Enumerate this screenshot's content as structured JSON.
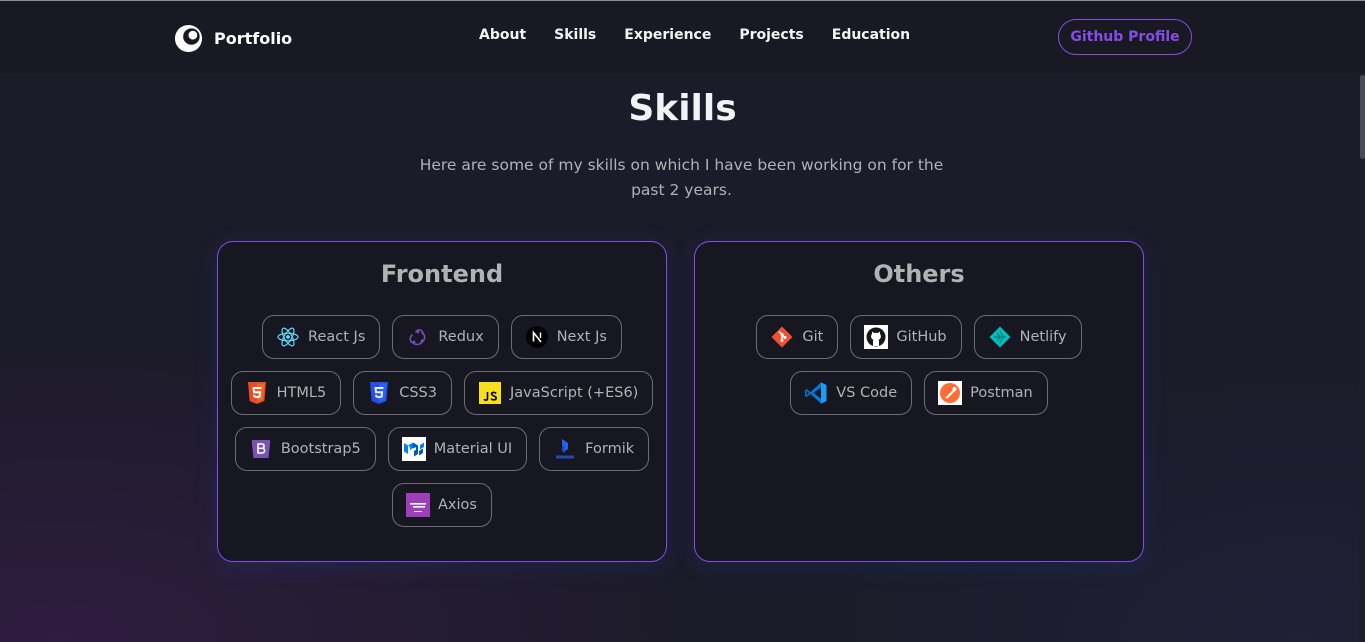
{
  "navbar": {
    "brand": "Portfolio",
    "links": [
      "About",
      "Skills",
      "Experience",
      "Projects",
      "Education"
    ],
    "github_button": "Github Profile"
  },
  "skills_section": {
    "title": "Skills",
    "description": "Here are some of my skills on which I have been working on for the past 2 years."
  },
  "categories": [
    {
      "title": "Frontend",
      "skills": [
        {
          "name": "React Js",
          "icon": "react-icon"
        },
        {
          "name": "Redux",
          "icon": "redux-icon"
        },
        {
          "name": "Next Js",
          "icon": "nextjs-icon"
        },
        {
          "name": "HTML5",
          "icon": "html5-icon"
        },
        {
          "name": "CSS3",
          "icon": "css3-icon"
        },
        {
          "name": "JavaScript (+ES6)",
          "icon": "javascript-icon"
        },
        {
          "name": "Bootstrap5",
          "icon": "bootstrap-icon"
        },
        {
          "name": "Material UI",
          "icon": "material-ui-icon"
        },
        {
          "name": "Formik",
          "icon": "formik-icon"
        },
        {
          "name": "Axios",
          "icon": "axios-icon"
        }
      ]
    },
    {
      "title": "Others",
      "skills": [
        {
          "name": "Git",
          "icon": "git-icon"
        },
        {
          "name": "GitHub",
          "icon": "github-icon"
        },
        {
          "name": "Netlify",
          "icon": "netlify-icon"
        },
        {
          "name": "VS Code",
          "icon": "vscode-icon"
        },
        {
          "name": "Postman",
          "icon": "postman-icon"
        }
      ]
    }
  ],
  "colors": {
    "background": "#1c1b29",
    "navbar": "#191924",
    "accent": "#854ce6",
    "card": "#171721",
    "text_primary": "#f2f3f4",
    "text_secondary": "#b1b2b3"
  }
}
